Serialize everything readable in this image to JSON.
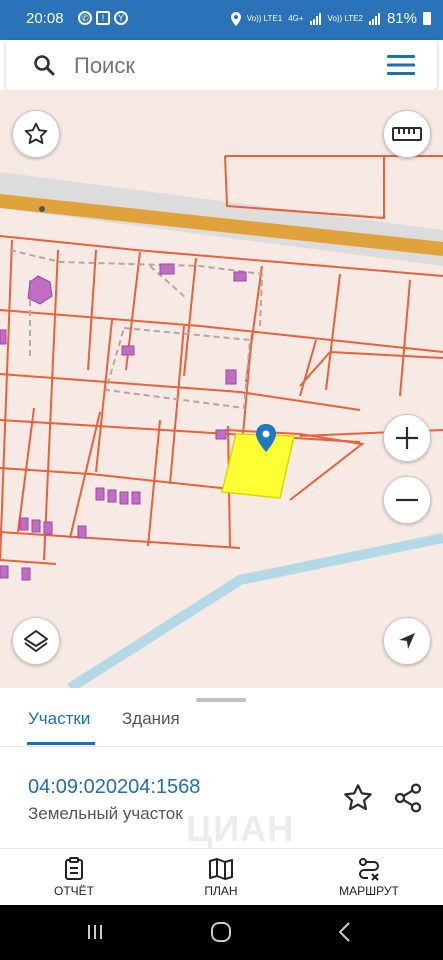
{
  "status_bar": {
    "time": "20:08",
    "network_left": "Vo)) LTE1",
    "network_mid": "4G+",
    "network_right": "Vo)) LTE2",
    "battery": "81%"
  },
  "search": {
    "placeholder": "Поиск"
  },
  "map": {
    "parcel_fill": "#ffff33",
    "boundary_color": "#e8613a",
    "building_color": "#c26cc4",
    "road_color": "#e0a23a",
    "water_color": "#b3d9e6",
    "marker_color": "#1f78c1"
  },
  "sheet": {
    "tabs": [
      {
        "label": "Участки"
      },
      {
        "label": "Здания"
      }
    ],
    "cadastral_number": "04:09:020204:1568",
    "object_type": "Земельный участок",
    "watermark": "ЦИАН"
  },
  "actions": [
    {
      "label": "ОТЧЁТ",
      "icon": "report-icon"
    },
    {
      "label": "ПЛАН",
      "icon": "map-plan-icon"
    },
    {
      "label": "МАРШРУТ",
      "icon": "route-icon"
    }
  ],
  "accent_color": "#1a6fb5"
}
